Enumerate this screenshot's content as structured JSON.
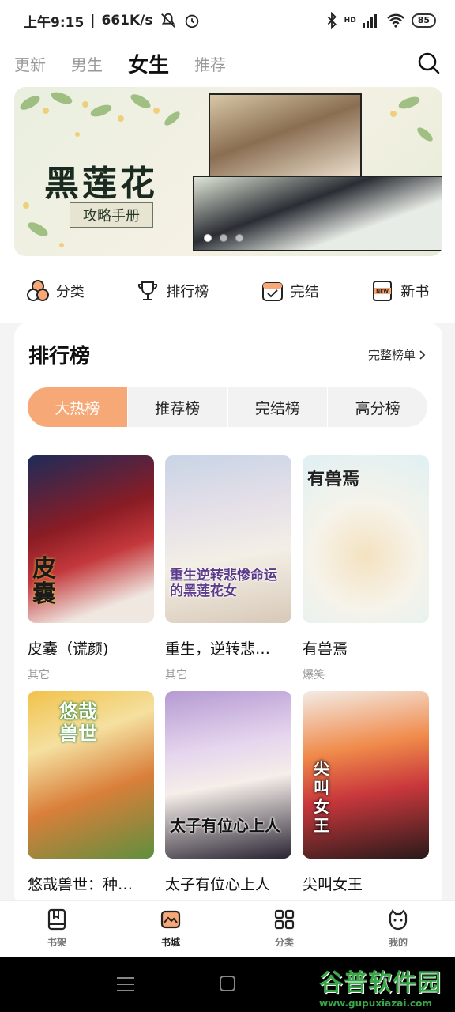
{
  "status": {
    "time": "上午9:15",
    "speed": "661K/s",
    "hd": "HD",
    "battery": "85"
  },
  "top_tabs": [
    "更新",
    "男生",
    "女生",
    "推荐"
  ],
  "active_tab": "女生",
  "banner": {
    "title": "黑莲花",
    "subtitle": "攻略手册",
    "page_count": 3,
    "active_page": 0
  },
  "quick_links": [
    {
      "label": "分类",
      "icon": "category-icon"
    },
    {
      "label": "排行榜",
      "icon": "trophy-icon"
    },
    {
      "label": "完结",
      "icon": "calendar-check-icon"
    },
    {
      "label": "新书",
      "icon": "new-book-icon"
    }
  ],
  "ranking": {
    "title": "排行榜",
    "full_list": "完整榜单",
    "segments": [
      "大热榜",
      "推荐榜",
      "完结榜",
      "高分榜"
    ],
    "active_segment": "大热榜",
    "books": [
      {
        "title": "皮囊（谎颜)",
        "category": "其它",
        "cover_text": "皮囊"
      },
      {
        "title": "重生，逆转悲…",
        "category": "其它",
        "cover_text": "重生逆转悲惨命运的黑莲花女"
      },
      {
        "title": "有兽焉",
        "category": "爆笑",
        "cover_text": "有兽焉"
      },
      {
        "title": "悠哉兽世：种…",
        "category": "",
        "cover_text": "悠哉兽世"
      },
      {
        "title": "太子有位心上人",
        "category": "",
        "cover_text": "太子有位心上人"
      },
      {
        "title": "尖叫女王",
        "category": "",
        "cover_text": "尖叫女王"
      }
    ]
  },
  "bottom_nav": [
    {
      "label": "书架",
      "icon": "bookshelf-icon"
    },
    {
      "label": "书城",
      "icon": "bookstore-icon"
    },
    {
      "label": "分类",
      "icon": "grid-icon"
    },
    {
      "label": "我的",
      "icon": "profile-icon"
    }
  ],
  "active_bottom": "书城",
  "watermark": {
    "main": "谷普软件园",
    "url": "www.gupuxiazai.com"
  },
  "colors": {
    "accent": "#f7a877",
    "text": "#222222"
  }
}
